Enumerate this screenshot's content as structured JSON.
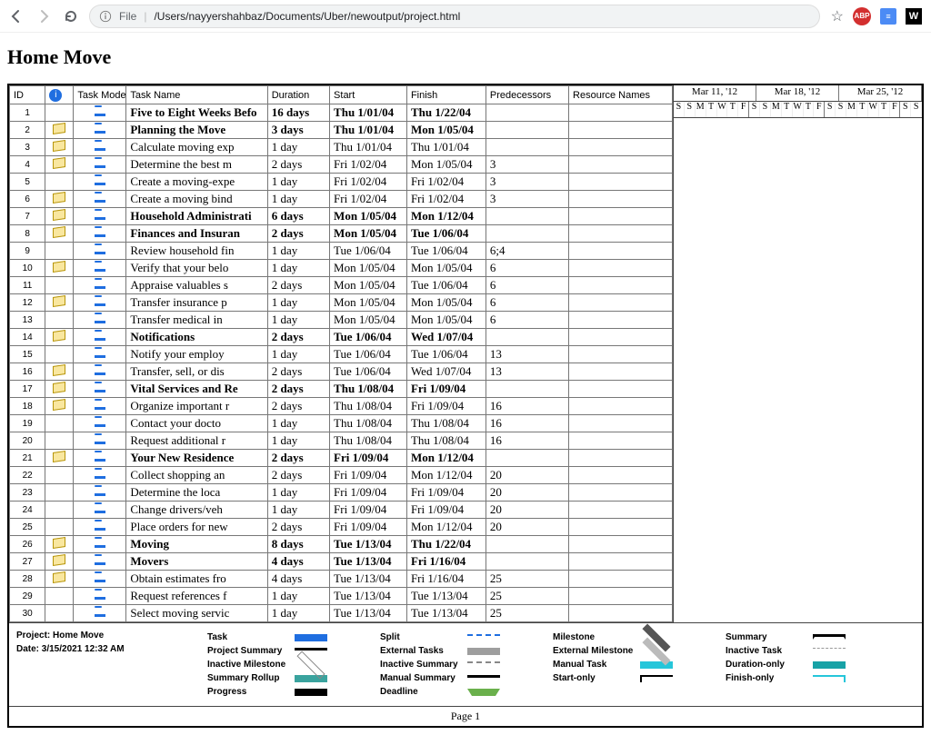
{
  "browser": {
    "urlScheme": "File",
    "urlPath": "/Users/nayyershahbaz/Documents/Uber/newoutput/project.html",
    "extAbp": "ABP",
    "extSq": "≡",
    "extW": "W"
  },
  "page": {
    "title": "Home Move",
    "footer": "Page 1"
  },
  "columns": {
    "id": "ID",
    "info": "",
    "mode": "Task Mode",
    "name": "Task Name",
    "duration": "Duration",
    "start": "Start",
    "finish": "Finish",
    "predecessors": "Predecessors",
    "resources": "Resource Names"
  },
  "timeline": {
    "weeks": [
      "Mar 11, '12",
      "Mar 18, '12",
      "Mar 25, '12"
    ],
    "days": [
      "S",
      "S",
      "M",
      "T",
      "W",
      "T",
      "F",
      "S",
      "S",
      "M",
      "T",
      "W",
      "T",
      "F",
      "S",
      "S",
      "M",
      "T",
      "W",
      "T",
      "F",
      "S",
      "S"
    ]
  },
  "rows": [
    {
      "id": "1",
      "note": false,
      "indent": 0,
      "bold": true,
      "name": "Five to Eight Weeks Befo",
      "duration": "16 days",
      "start": "Thu 1/01/04",
      "finish": "Thu 1/22/04",
      "pred": ""
    },
    {
      "id": "2",
      "note": true,
      "indent": 1,
      "bold": true,
      "name": "Planning the Move",
      "duration": "3 days",
      "start": "Thu 1/01/04",
      "finish": "Mon 1/05/04",
      "pred": ""
    },
    {
      "id": "3",
      "note": true,
      "indent": 2,
      "bold": false,
      "name": "Calculate moving exp",
      "duration": "1 day",
      "start": "Thu 1/01/04",
      "finish": "Thu 1/01/04",
      "pred": ""
    },
    {
      "id": "4",
      "note": true,
      "indent": 2,
      "bold": false,
      "name": "Determine the best m",
      "duration": "2 days",
      "start": "Fri 1/02/04",
      "finish": "Mon 1/05/04",
      "pred": "3"
    },
    {
      "id": "5",
      "note": false,
      "indent": 2,
      "bold": false,
      "name": "Create a moving-expe",
      "duration": "1 day",
      "start": "Fri 1/02/04",
      "finish": "Fri 1/02/04",
      "pred": "3"
    },
    {
      "id": "6",
      "note": true,
      "indent": 2,
      "bold": false,
      "name": "Create a moving bind",
      "duration": "1 day",
      "start": "Fri 1/02/04",
      "finish": "Fri 1/02/04",
      "pred": "3"
    },
    {
      "id": "7",
      "note": true,
      "indent": 1,
      "bold": true,
      "name": "Household Administrati",
      "duration": "6 days",
      "start": "Mon 1/05/04",
      "finish": "Mon 1/12/04",
      "pred": ""
    },
    {
      "id": "8",
      "note": true,
      "indent": 1,
      "bold": true,
      "name": "Finances and Insuran",
      "duration": "2 days",
      "start": "Mon 1/05/04",
      "finish": "Tue 1/06/04",
      "pred": ""
    },
    {
      "id": "9",
      "note": false,
      "indent": 2,
      "bold": false,
      "name": "Review household fin",
      "duration": "1 day",
      "start": "Tue 1/06/04",
      "finish": "Tue 1/06/04",
      "pred": "6;4"
    },
    {
      "id": "10",
      "note": true,
      "indent": 2,
      "bold": false,
      "name": "Verify that your belo",
      "duration": "1 day",
      "start": "Mon 1/05/04",
      "finish": "Mon 1/05/04",
      "pred": "6"
    },
    {
      "id": "11",
      "note": false,
      "indent": 2,
      "bold": false,
      "name": "Appraise valuables s",
      "duration": "2 days",
      "start": "Mon 1/05/04",
      "finish": "Tue 1/06/04",
      "pred": "6"
    },
    {
      "id": "12",
      "note": true,
      "indent": 2,
      "bold": false,
      "name": "Transfer insurance p",
      "duration": "1 day",
      "start": "Mon 1/05/04",
      "finish": "Mon 1/05/04",
      "pred": "6"
    },
    {
      "id": "13",
      "note": false,
      "indent": 2,
      "bold": false,
      "name": "Transfer medical in",
      "duration": "1 day",
      "start": "Mon 1/05/04",
      "finish": "Mon 1/05/04",
      "pred": "6"
    },
    {
      "id": "14",
      "note": true,
      "indent": 1,
      "bold": true,
      "name": "Notifications",
      "duration": "2 days",
      "start": "Tue 1/06/04",
      "finish": "Wed 1/07/04",
      "pred": ""
    },
    {
      "id": "15",
      "note": false,
      "indent": 2,
      "bold": false,
      "name": "Notify your employ",
      "duration": "1 day",
      "start": "Tue 1/06/04",
      "finish": "Tue 1/06/04",
      "pred": "13"
    },
    {
      "id": "16",
      "note": true,
      "indent": 2,
      "bold": false,
      "name": "Transfer, sell, or dis",
      "duration": "2 days",
      "start": "Tue 1/06/04",
      "finish": "Wed 1/07/04",
      "pred": "13"
    },
    {
      "id": "17",
      "note": true,
      "indent": 1,
      "bold": true,
      "name": "Vital Services and Re",
      "duration": "2 days",
      "start": "Thu 1/08/04",
      "finish": "Fri 1/09/04",
      "pred": ""
    },
    {
      "id": "18",
      "note": true,
      "indent": 2,
      "bold": false,
      "name": "Organize important r",
      "duration": "2 days",
      "start": "Thu 1/08/04",
      "finish": "Fri 1/09/04",
      "pred": "16"
    },
    {
      "id": "19",
      "note": false,
      "indent": 2,
      "bold": false,
      "name": "Contact your docto",
      "duration": "1 day",
      "start": "Thu 1/08/04",
      "finish": "Thu 1/08/04",
      "pred": "16"
    },
    {
      "id": "20",
      "note": false,
      "indent": 2,
      "bold": false,
      "name": "Request additional r",
      "duration": "1 day",
      "start": "Thu 1/08/04",
      "finish": "Thu 1/08/04",
      "pred": "16"
    },
    {
      "id": "21",
      "note": true,
      "indent": 1,
      "bold": true,
      "name": "Your New Residence",
      "duration": "2 days",
      "start": "Fri 1/09/04",
      "finish": "Mon 1/12/04",
      "pred": ""
    },
    {
      "id": "22",
      "note": false,
      "indent": 2,
      "bold": false,
      "name": "Collect shopping an",
      "duration": "2 days",
      "start": "Fri 1/09/04",
      "finish": "Mon 1/12/04",
      "pred": "20"
    },
    {
      "id": "23",
      "note": false,
      "indent": 2,
      "bold": false,
      "name": "Determine the loca",
      "duration": "1 day",
      "start": "Fri 1/09/04",
      "finish": "Fri 1/09/04",
      "pred": "20"
    },
    {
      "id": "24",
      "note": false,
      "indent": 2,
      "bold": false,
      "name": "Change drivers/veh",
      "duration": "1 day",
      "start": "Fri 1/09/04",
      "finish": "Fri 1/09/04",
      "pred": "20"
    },
    {
      "id": "25",
      "note": false,
      "indent": 2,
      "bold": false,
      "name": "Place orders for new",
      "duration": "2 days",
      "start": "Fri 1/09/04",
      "finish": "Mon 1/12/04",
      "pred": "20"
    },
    {
      "id": "26",
      "note": true,
      "indent": 0,
      "bold": true,
      "name": "Moving",
      "duration": "8 days",
      "start": "Tue 1/13/04",
      "finish": "Thu 1/22/04",
      "pred": ""
    },
    {
      "id": "27",
      "note": true,
      "indent": 1,
      "bold": true,
      "name": "Movers",
      "duration": "4 days",
      "start": "Tue 1/13/04",
      "finish": "Fri 1/16/04",
      "pred": ""
    },
    {
      "id": "28",
      "note": true,
      "indent": 2,
      "bold": false,
      "name": "Obtain estimates fro",
      "duration": "4 days",
      "start": "Tue 1/13/04",
      "finish": "Fri 1/16/04",
      "pred": "25"
    },
    {
      "id": "29",
      "note": false,
      "indent": 2,
      "bold": false,
      "name": "Request references f",
      "duration": "1 day",
      "start": "Tue 1/13/04",
      "finish": "Tue 1/13/04",
      "pred": "25"
    },
    {
      "id": "30",
      "note": false,
      "indent": 2,
      "bold": false,
      "name": "Select moving servic",
      "duration": "1 day",
      "start": "Tue 1/13/04",
      "finish": "Tue 1/13/04",
      "pred": "25"
    }
  ],
  "legend": {
    "projectLabel": "Project: Home Move",
    "dateLabel": "Date: 3/15/2021 12:32 AM",
    "items": [
      {
        "label": "Task",
        "cls": "sw-task"
      },
      {
        "label": "Split",
        "cls": "sw-split"
      },
      {
        "label": "Milestone",
        "cls": "sw-milestone"
      },
      {
        "label": "Summary",
        "cls": "sw-summary"
      },
      {
        "label": "Project Summary",
        "cls": "sw-projectsummary"
      },
      {
        "label": "External Tasks",
        "cls": "sw-ext"
      },
      {
        "label": "External Milestone",
        "cls": "sw-extmilestone"
      },
      {
        "label": "Inactive Task",
        "cls": "sw-inactive"
      },
      {
        "label": "Inactive Milestone",
        "cls": "sw-inactivemilestone"
      },
      {
        "label": "Inactive Summary",
        "cls": "sw-inactivesummary"
      },
      {
        "label": "Manual Task",
        "cls": "sw-manual"
      },
      {
        "label": "Duration-only",
        "cls": "sw-durationonly"
      },
      {
        "label": "Summary Rollup",
        "cls": "sw-rollup"
      },
      {
        "label": "Manual Summary",
        "cls": "sw-manualsummary"
      },
      {
        "label": "Start-only",
        "cls": "sw-startonly"
      },
      {
        "label": "Finish-only",
        "cls": "sw-finishonly"
      },
      {
        "label": "Progress",
        "cls": "sw-progress"
      },
      {
        "label": "Deadline",
        "cls": "sw-deadline"
      }
    ]
  }
}
